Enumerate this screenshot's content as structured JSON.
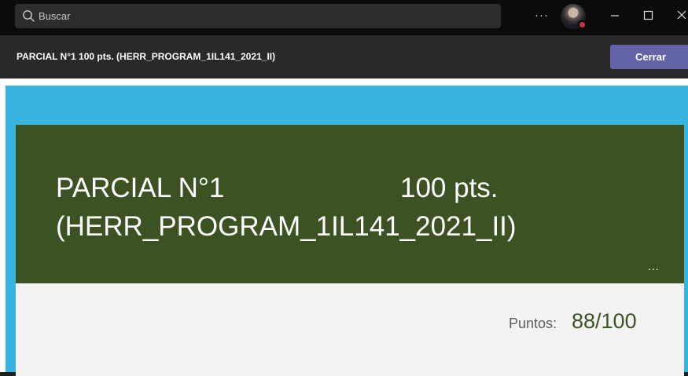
{
  "search": {
    "placeholder": "Buscar"
  },
  "titlebar": {
    "more_label": "···",
    "presence_color": "#c4314b"
  },
  "header": {
    "title": "PARCIAL N°1 100 pts. (HERR_PROGRAM_1IL141_2021_II)",
    "close_label": "Cerrar"
  },
  "form": {
    "title": "PARCIAL N°1                       100 pts. (HERR_PROGRAM_1IL141_2021_II)",
    "menu_label": "...",
    "points_label": "Puntos:",
    "points_value": "88/100"
  },
  "colors": {
    "banner": "#3c5223",
    "frame": "#38b4de",
    "accent_button": "#6264a7"
  }
}
